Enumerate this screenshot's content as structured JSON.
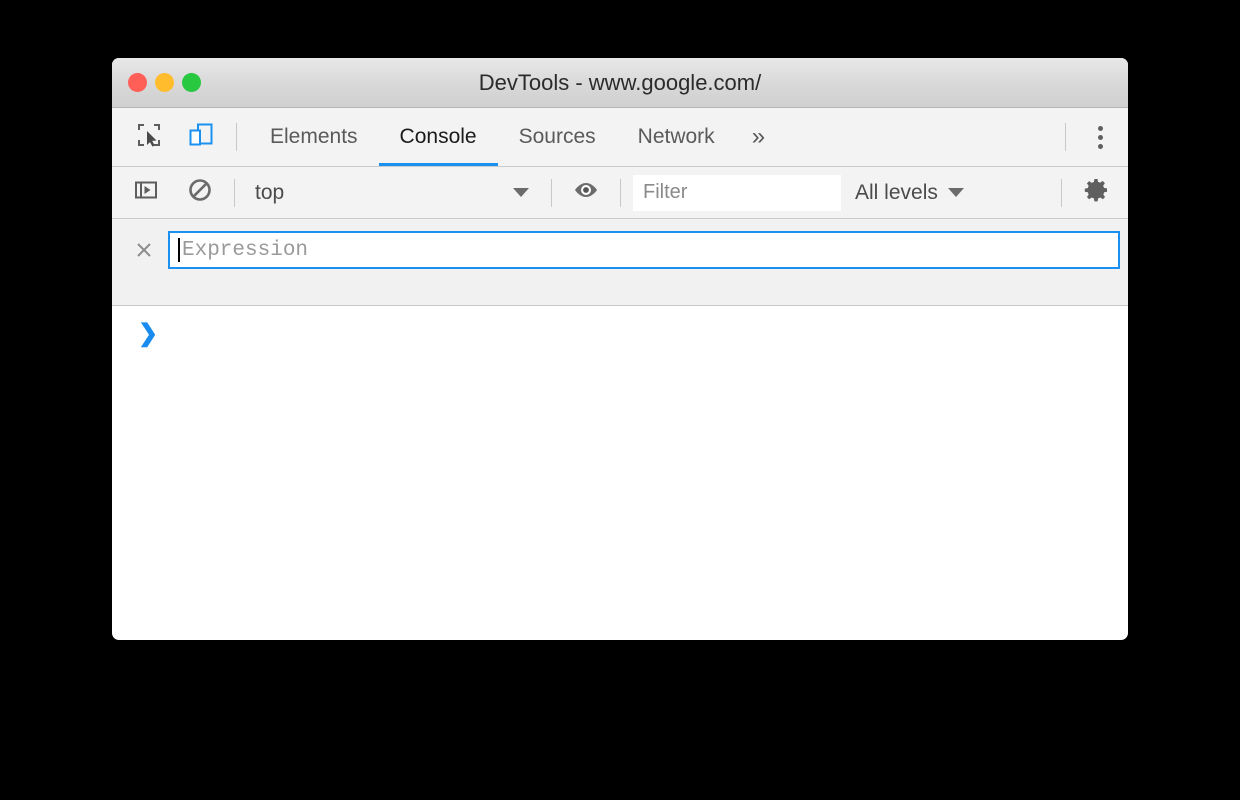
{
  "window": {
    "title": "DevTools - www.google.com/",
    "traffic_lights": [
      {
        "name": "close",
        "color": "#ff5f57"
      },
      {
        "name": "minimize",
        "color": "#ffbd2e"
      },
      {
        "name": "zoom",
        "color": "#28c840"
      }
    ]
  },
  "tabbar": {
    "inspect_icon": "inspect-element-icon",
    "device_icon": "device-toolbar-icon",
    "overflow_label": "»",
    "menu_icon": "more-options-icon",
    "tabs": [
      {
        "label": "Elements",
        "active": false
      },
      {
        "label": "Console",
        "active": true
      },
      {
        "label": "Sources",
        "active": false
      },
      {
        "label": "Network",
        "active": false
      }
    ]
  },
  "console_toolbar": {
    "sidebar_toggle_icon": "console-sidebar-icon",
    "clear_icon": "clear-console-icon",
    "context": "top",
    "eye_icon": "live-expression-eye-icon",
    "filter_placeholder": "Filter",
    "filter_value": "",
    "levels": "All levels",
    "settings_icon": "settings-gear-icon"
  },
  "live_expression": {
    "close_label": "×",
    "placeholder": "Expression",
    "value": ""
  },
  "console_output": {
    "prompt": "❯"
  },
  "colors": {
    "accent": "#1a90f0",
    "toolbar_bg": "#f3f3f3",
    "panel_bg": "#f1f1f1",
    "text": "#4b4b4b"
  }
}
